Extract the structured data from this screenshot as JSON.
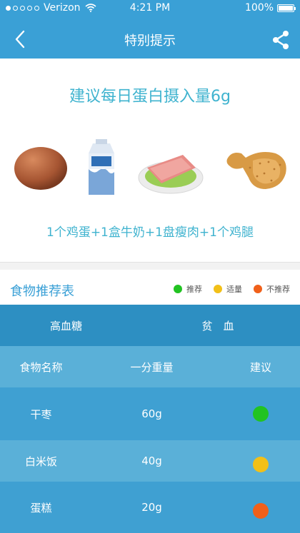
{
  "status_bar": {
    "carrier": "Verizon",
    "time": "4:21 PM",
    "battery": "100%"
  },
  "nav": {
    "title": "特别提示"
  },
  "main": {
    "title": "建议每日蛋白摄入量6g",
    "foods": [
      "egg-icon",
      "milk-carton-icon",
      "lean-meat-plate-icon",
      "chicken-leg-icon"
    ],
    "combo_text": "1个鸡蛋+1盒牛奶+1盘瘦肉+1个鸡腿"
  },
  "section": {
    "title": "食物推荐表",
    "legend": [
      {
        "label": "推荐",
        "color": "#22c322"
      },
      {
        "label": "适量",
        "color": "#f2c018"
      },
      {
        "label": "不推荐",
        "color": "#f0601a"
      }
    ]
  },
  "table": {
    "categories": [
      "高血糖",
      "贫　血"
    ],
    "headers": [
      "食物名称",
      "一分重量",
      "建议"
    ],
    "rows": [
      {
        "name": "干枣",
        "weight": "60g",
        "advice_color": "#22c322"
      },
      {
        "name": "白米饭",
        "weight": "40g",
        "advice_color": "#f2c018"
      },
      {
        "name": "蛋糕",
        "weight": "20g",
        "advice_color": "#f0601a"
      }
    ]
  },
  "colors": {
    "header": "#3aa0d6",
    "accent_text": "#3fb3cf"
  }
}
